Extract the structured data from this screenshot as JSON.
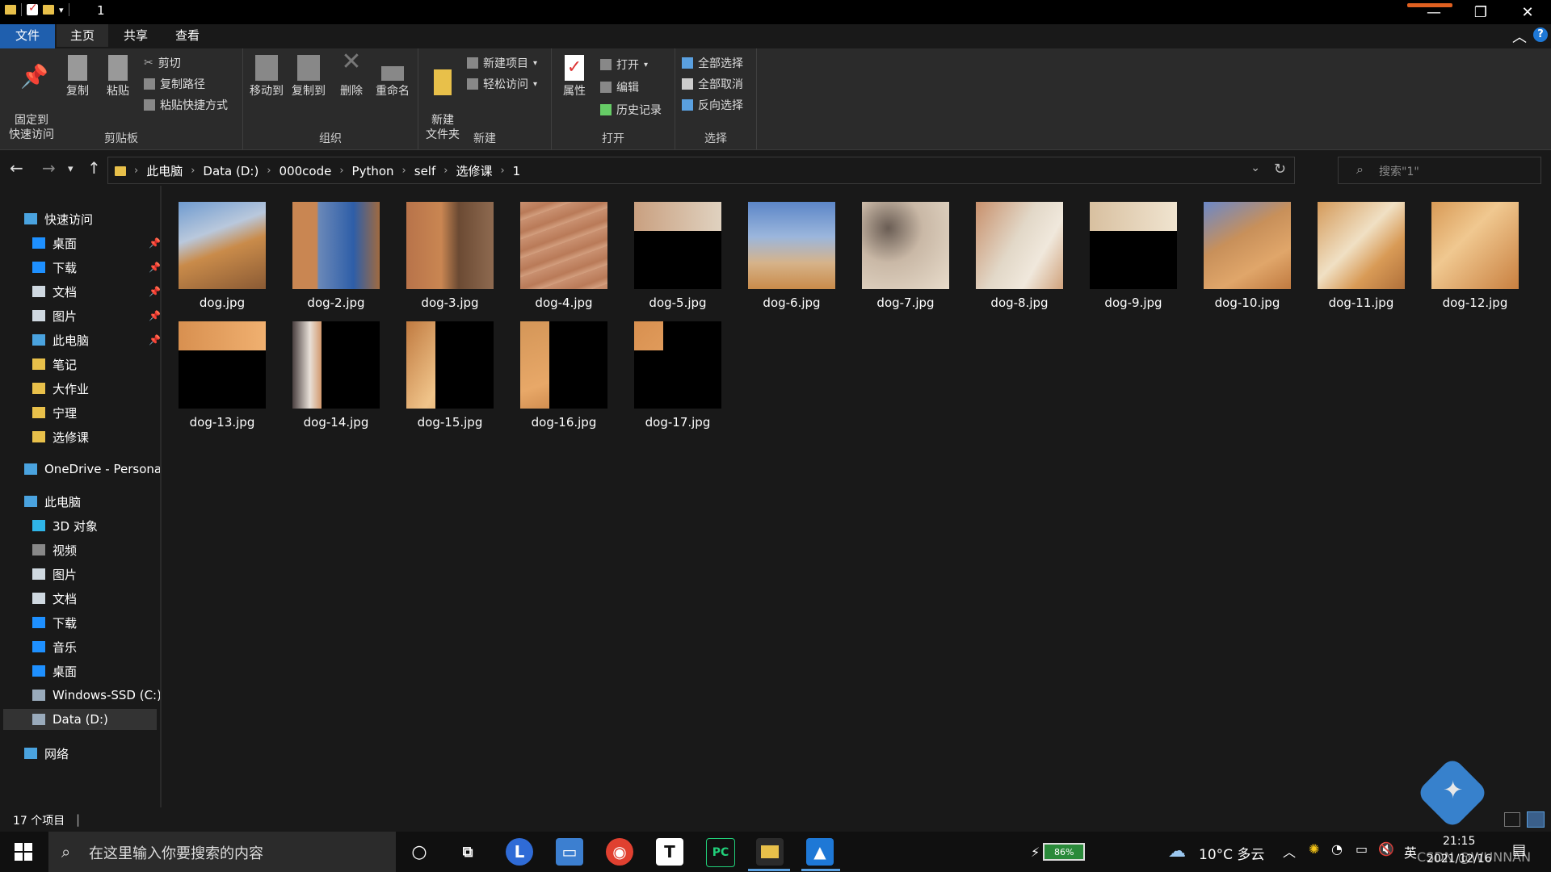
{
  "window": {
    "title": "1"
  },
  "tabs": [
    "文件",
    "主页",
    "共享",
    "查看"
  ],
  "ribbon": {
    "clipboard": {
      "label": "剪贴板",
      "pin": "固定到\n快速访问",
      "copy": "复制",
      "paste": "粘贴",
      "cut": "剪切",
      "copy_path": "复制路径",
      "paste_shortcut": "粘贴快捷方式"
    },
    "organize": {
      "label": "组织",
      "move_to": "移动到",
      "copy_to": "复制到",
      "delete": "删除",
      "rename": "重命名"
    },
    "new": {
      "label": "新建",
      "new_folder": "新建\n文件夹",
      "new_item": "新建项目",
      "easy_access": "轻松访问"
    },
    "open": {
      "label": "打开",
      "properties": "属性",
      "open": "打开",
      "edit": "编辑",
      "history": "历史记录"
    },
    "select": {
      "label": "选择",
      "select_all": "全部选择",
      "select_none": "全部取消",
      "invert": "反向选择"
    }
  },
  "address": {
    "crumbs": [
      "此电脑",
      "Data (D:)",
      "000code",
      "Python",
      "self",
      "选修课",
      "1"
    ]
  },
  "search": {
    "placeholder": "搜索\"1\""
  },
  "sidebar": {
    "quick_access": "快速访问",
    "quick_items": [
      {
        "label": "桌面",
        "icon": "desktop-icon",
        "color": "#1e90ff",
        "pinned": true
      },
      {
        "label": "下载",
        "icon": "download-icon",
        "color": "#1e90ff",
        "pinned": true
      },
      {
        "label": "文档",
        "icon": "document-icon",
        "color": "#cfd8e0",
        "pinned": true
      },
      {
        "label": "图片",
        "icon": "pictures-icon",
        "color": "#cfd8e0",
        "pinned": true
      },
      {
        "label": "此电脑",
        "icon": "computer-icon",
        "color": "#4aa3df",
        "pinned": true
      },
      {
        "label": "笔记",
        "icon": "folder-icon",
        "color": "#e8c04a",
        "pinned": false
      },
      {
        "label": "大作业",
        "icon": "folder-icon",
        "color": "#e8c04a",
        "pinned": false
      },
      {
        "label": "宁理",
        "icon": "folder-icon",
        "color": "#e8c04a",
        "pinned": false
      },
      {
        "label": "选修课",
        "icon": "folder-icon",
        "color": "#e8c04a",
        "pinned": false
      }
    ],
    "onedrive": "OneDrive - Persona",
    "this_pc": "此电脑",
    "pc_items": [
      {
        "label": "3D 对象",
        "icon": "3d-objects-icon",
        "color": "#2fb5e8"
      },
      {
        "label": "视频",
        "icon": "video-icon",
        "color": "#888"
      },
      {
        "label": "图片",
        "icon": "pictures-icon",
        "color": "#cfd8e0"
      },
      {
        "label": "文档",
        "icon": "document-icon",
        "color": "#cfd8e0"
      },
      {
        "label": "下载",
        "icon": "download-icon",
        "color": "#1e90ff"
      },
      {
        "label": "音乐",
        "icon": "music-icon",
        "color": "#1e90ff"
      },
      {
        "label": "桌面",
        "icon": "desktop-icon",
        "color": "#1e90ff"
      },
      {
        "label": "Windows-SSD (C:)",
        "icon": "drive-icon",
        "color": "#9ab"
      },
      {
        "label": "Data (D:)",
        "icon": "drive-icon",
        "color": "#9ab"
      }
    ],
    "network": "网络"
  },
  "files": [
    {
      "name": "dog.jpg",
      "bg": "linear-gradient(160deg,#6f9bd0 0%,#b9c8dc 35%,#c98b4a 55%,#8a5a34 100%)",
      "black": "none"
    },
    {
      "name": "dog-2.jpg",
      "bg": "linear-gradient(90deg,#c98652 0%,#c98652 28%,#6a88b8 30%,#2e5ea8 70%,#a06a40 100%)",
      "black": "none"
    },
    {
      "name": "dog-3.jpg",
      "bg": "linear-gradient(90deg,#b8734a 0%,#c98652 40%,#6b4a33 60%,#8e6a50 100%)",
      "black": "none"
    },
    {
      "name": "dog-4.jpg",
      "bg": "repeating-linear-gradient(160deg,#c99070 0px,#b97a58 14px,#d4a080 22px)",
      "black": "none"
    },
    {
      "name": "dog-5.jpg",
      "bg": "linear-gradient(90deg,#c9a080,#e0d2c0)",
      "black": "bottom-68"
    },
    {
      "name": "dog-6.jpg",
      "bg": "linear-gradient(180deg,#5c86c8 0%,#9bb6dc 40%,#d6b38a 70%,#c98b4a 100%)",
      "black": "none"
    },
    {
      "name": "dog-7.jpg",
      "bg": "radial-gradient(circle at 30% 30%,#6a5d54 0%,#c9b8a6 40%,#e8dccb 100%)",
      "black": "none"
    },
    {
      "name": "dog-8.jpg",
      "bg": "linear-gradient(120deg,#c8906c 0%,#e2d8c8 45%,#f0e8dc 70%,#d0a27c 100%)",
      "black": "none"
    },
    {
      "name": "dog-9.jpg",
      "bg": "linear-gradient(90deg,#d8c0a0,#f0e4d0)",
      "black": "bottom-72"
    },
    {
      "name": "dog-10.jpg",
      "bg": "linear-gradient(150deg,#6b88c8 0%,#c8905a 40%,#e0a66a 70%,#c07a40 100%)",
      "black": "none"
    },
    {
      "name": "dog-11.jpg",
      "bg": "linear-gradient(135deg,#d49a5a 0%,#f0e0c4 45%,#d89a56 70%,#b0703a 100%)",
      "black": "none"
    },
    {
      "name": "dog-12.jpg",
      "bg": "linear-gradient(135deg,#d89a56 0%,#f0c890 40%,#c98040 100%)",
      "black": "none"
    },
    {
      "name": "dog-13.jpg",
      "bg": "linear-gradient(90deg,#d89050,#f0b070)",
      "black": "bottom-72"
    },
    {
      "name": "dog-14.jpg",
      "bg": "linear-gradient(90deg,#4a4040 0%,#e8e0d8 20%,#d09060 35%)",
      "black": "right-70"
    },
    {
      "name": "dog-15.jpg",
      "bg": "linear-gradient(120deg,#c07a40 0%,#f0c48a 50%,#d08a48 100%)",
      "black": "right-70"
    },
    {
      "name": "dog-16.jpg",
      "bg": "linear-gradient(160deg,#d49658 0%,#e8a868 60%,#c07a3e 100%)",
      "black": "right-70"
    },
    {
      "name": "dog-17.jpg",
      "bg": "linear-gradient(135deg,#d89050,#f0b070)",
      "black": "corner"
    }
  ],
  "status": {
    "count": "17 个项目"
  },
  "taskbar": {
    "search_placeholder": "在这里输入你要搜索的内容",
    "battery": "86%",
    "weather": "10°C  多云",
    "lang": "英",
    "time": "21:15",
    "date": "2021/12/16",
    "watermark": "CSDN @WUNNAN"
  }
}
